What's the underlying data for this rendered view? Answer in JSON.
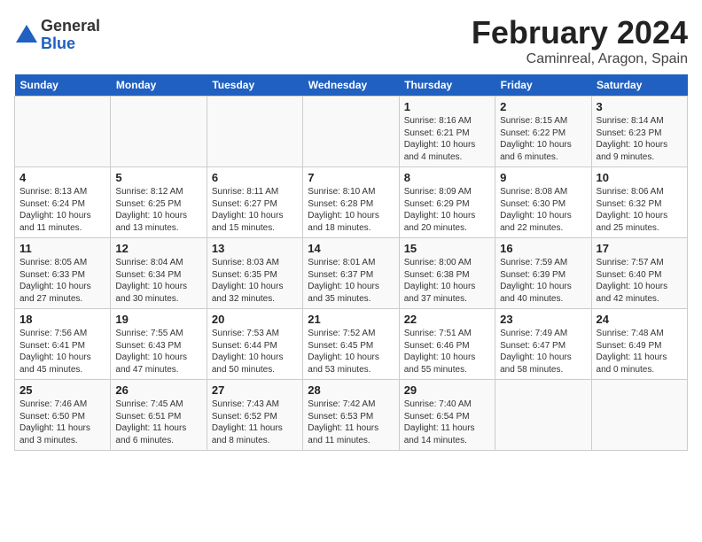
{
  "logo": {
    "general": "General",
    "blue": "Blue"
  },
  "title": "February 2024",
  "subtitle": "Caminreal, Aragon, Spain",
  "headers": [
    "Sunday",
    "Monday",
    "Tuesday",
    "Wednesday",
    "Thursday",
    "Friday",
    "Saturday"
  ],
  "weeks": [
    [
      {
        "day": "",
        "info": ""
      },
      {
        "day": "",
        "info": ""
      },
      {
        "day": "",
        "info": ""
      },
      {
        "day": "",
        "info": ""
      },
      {
        "day": "1",
        "info": "Sunrise: 8:16 AM\nSunset: 6:21 PM\nDaylight: 10 hours\nand 4 minutes."
      },
      {
        "day": "2",
        "info": "Sunrise: 8:15 AM\nSunset: 6:22 PM\nDaylight: 10 hours\nand 6 minutes."
      },
      {
        "day": "3",
        "info": "Sunrise: 8:14 AM\nSunset: 6:23 PM\nDaylight: 10 hours\nand 9 minutes."
      }
    ],
    [
      {
        "day": "4",
        "info": "Sunrise: 8:13 AM\nSunset: 6:24 PM\nDaylight: 10 hours\nand 11 minutes."
      },
      {
        "day": "5",
        "info": "Sunrise: 8:12 AM\nSunset: 6:25 PM\nDaylight: 10 hours\nand 13 minutes."
      },
      {
        "day": "6",
        "info": "Sunrise: 8:11 AM\nSunset: 6:27 PM\nDaylight: 10 hours\nand 15 minutes."
      },
      {
        "day": "7",
        "info": "Sunrise: 8:10 AM\nSunset: 6:28 PM\nDaylight: 10 hours\nand 18 minutes."
      },
      {
        "day": "8",
        "info": "Sunrise: 8:09 AM\nSunset: 6:29 PM\nDaylight: 10 hours\nand 20 minutes."
      },
      {
        "day": "9",
        "info": "Sunrise: 8:08 AM\nSunset: 6:30 PM\nDaylight: 10 hours\nand 22 minutes."
      },
      {
        "day": "10",
        "info": "Sunrise: 8:06 AM\nSunset: 6:32 PM\nDaylight: 10 hours\nand 25 minutes."
      }
    ],
    [
      {
        "day": "11",
        "info": "Sunrise: 8:05 AM\nSunset: 6:33 PM\nDaylight: 10 hours\nand 27 minutes."
      },
      {
        "day": "12",
        "info": "Sunrise: 8:04 AM\nSunset: 6:34 PM\nDaylight: 10 hours\nand 30 minutes."
      },
      {
        "day": "13",
        "info": "Sunrise: 8:03 AM\nSunset: 6:35 PM\nDaylight: 10 hours\nand 32 minutes."
      },
      {
        "day": "14",
        "info": "Sunrise: 8:01 AM\nSunset: 6:37 PM\nDaylight: 10 hours\nand 35 minutes."
      },
      {
        "day": "15",
        "info": "Sunrise: 8:00 AM\nSunset: 6:38 PM\nDaylight: 10 hours\nand 37 minutes."
      },
      {
        "day": "16",
        "info": "Sunrise: 7:59 AM\nSunset: 6:39 PM\nDaylight: 10 hours\nand 40 minutes."
      },
      {
        "day": "17",
        "info": "Sunrise: 7:57 AM\nSunset: 6:40 PM\nDaylight: 10 hours\nand 42 minutes."
      }
    ],
    [
      {
        "day": "18",
        "info": "Sunrise: 7:56 AM\nSunset: 6:41 PM\nDaylight: 10 hours\nand 45 minutes."
      },
      {
        "day": "19",
        "info": "Sunrise: 7:55 AM\nSunset: 6:43 PM\nDaylight: 10 hours\nand 47 minutes."
      },
      {
        "day": "20",
        "info": "Sunrise: 7:53 AM\nSunset: 6:44 PM\nDaylight: 10 hours\nand 50 minutes."
      },
      {
        "day": "21",
        "info": "Sunrise: 7:52 AM\nSunset: 6:45 PM\nDaylight: 10 hours\nand 53 minutes."
      },
      {
        "day": "22",
        "info": "Sunrise: 7:51 AM\nSunset: 6:46 PM\nDaylight: 10 hours\nand 55 minutes."
      },
      {
        "day": "23",
        "info": "Sunrise: 7:49 AM\nSunset: 6:47 PM\nDaylight: 10 hours\nand 58 minutes."
      },
      {
        "day": "24",
        "info": "Sunrise: 7:48 AM\nSunset: 6:49 PM\nDaylight: 11 hours\nand 0 minutes."
      }
    ],
    [
      {
        "day": "25",
        "info": "Sunrise: 7:46 AM\nSunset: 6:50 PM\nDaylight: 11 hours\nand 3 minutes."
      },
      {
        "day": "26",
        "info": "Sunrise: 7:45 AM\nSunset: 6:51 PM\nDaylight: 11 hours\nand 6 minutes."
      },
      {
        "day": "27",
        "info": "Sunrise: 7:43 AM\nSunset: 6:52 PM\nDaylight: 11 hours\nand 8 minutes."
      },
      {
        "day": "28",
        "info": "Sunrise: 7:42 AM\nSunset: 6:53 PM\nDaylight: 11 hours\nand 11 minutes."
      },
      {
        "day": "29",
        "info": "Sunrise: 7:40 AM\nSunset: 6:54 PM\nDaylight: 11 hours\nand 14 minutes."
      },
      {
        "day": "",
        "info": ""
      },
      {
        "day": "",
        "info": ""
      }
    ]
  ]
}
